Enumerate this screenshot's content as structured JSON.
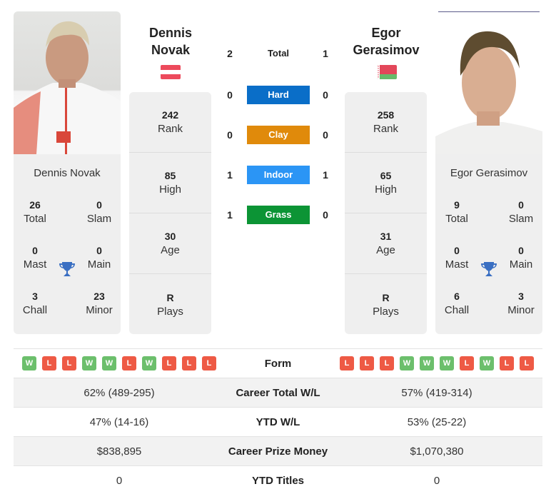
{
  "colors": {
    "hard": "#0a6ec8",
    "clay": "#e08a0b",
    "indoor": "#2b95f5",
    "grass": "#0c9435",
    "win": "#6cbf6c",
    "loss": "#ee5a45",
    "trophy": "#3a6fc2"
  },
  "player1": {
    "name_line1": "Dennis",
    "name_line2": "Novak",
    "full_name": "Dennis Novak",
    "flag": "austria-flag",
    "rank": "242",
    "rank_label": "Rank",
    "high": "85",
    "high_label": "High",
    "age": "30",
    "age_label": "Age",
    "plays": "R",
    "plays_label": "Plays",
    "titles": {
      "total": "26",
      "total_label": "Total",
      "slam": "0",
      "slam_label": "Slam",
      "mast": "0",
      "mast_label": "Mast",
      "main": "0",
      "main_label": "Main",
      "chall": "3",
      "chall_label": "Chall",
      "minor": "23",
      "minor_label": "Minor"
    },
    "form": [
      "W",
      "L",
      "L",
      "W",
      "W",
      "L",
      "W",
      "L",
      "L",
      "L"
    ],
    "career_wl": "62% (489-295)",
    "ytd_wl": "47% (14-16)",
    "prize_money": "$838,895",
    "ytd_titles": "0"
  },
  "player2": {
    "name_line1": "Egor",
    "name_line2": "Gerasimov",
    "full_name": "Egor Gerasimov",
    "flag": "belarus-flag",
    "rank": "258",
    "rank_label": "Rank",
    "high": "65",
    "high_label": "High",
    "age": "31",
    "age_label": "Age",
    "plays": "R",
    "plays_label": "Plays",
    "titles": {
      "total": "9",
      "total_label": "Total",
      "slam": "0",
      "slam_label": "Slam",
      "mast": "0",
      "mast_label": "Mast",
      "main": "0",
      "main_label": "Main",
      "chall": "6",
      "chall_label": "Chall",
      "minor": "3",
      "minor_label": "Minor"
    },
    "form": [
      "L",
      "L",
      "L",
      "W",
      "W",
      "W",
      "L",
      "W",
      "L",
      "L"
    ],
    "career_wl": "57% (419-314)",
    "ytd_wl": "53% (25-22)",
    "prize_money": "$1,070,380",
    "ytd_titles": "0"
  },
  "h2h": [
    {
      "label": "Total",
      "p1": "2",
      "p2": "1"
    },
    {
      "label": "Hard",
      "p1": "0",
      "p2": "0"
    },
    {
      "label": "Clay",
      "p1": "0",
      "p2": "0"
    },
    {
      "label": "Indoor",
      "p1": "1",
      "p2": "1"
    },
    {
      "label": "Grass",
      "p1": "1",
      "p2": "0"
    }
  ],
  "table_labels": {
    "form": "Form",
    "career_wl": "Career Total W/L",
    "ytd_wl": "YTD W/L",
    "prize_money": "Career Prize Money",
    "ytd_titles": "YTD Titles"
  }
}
